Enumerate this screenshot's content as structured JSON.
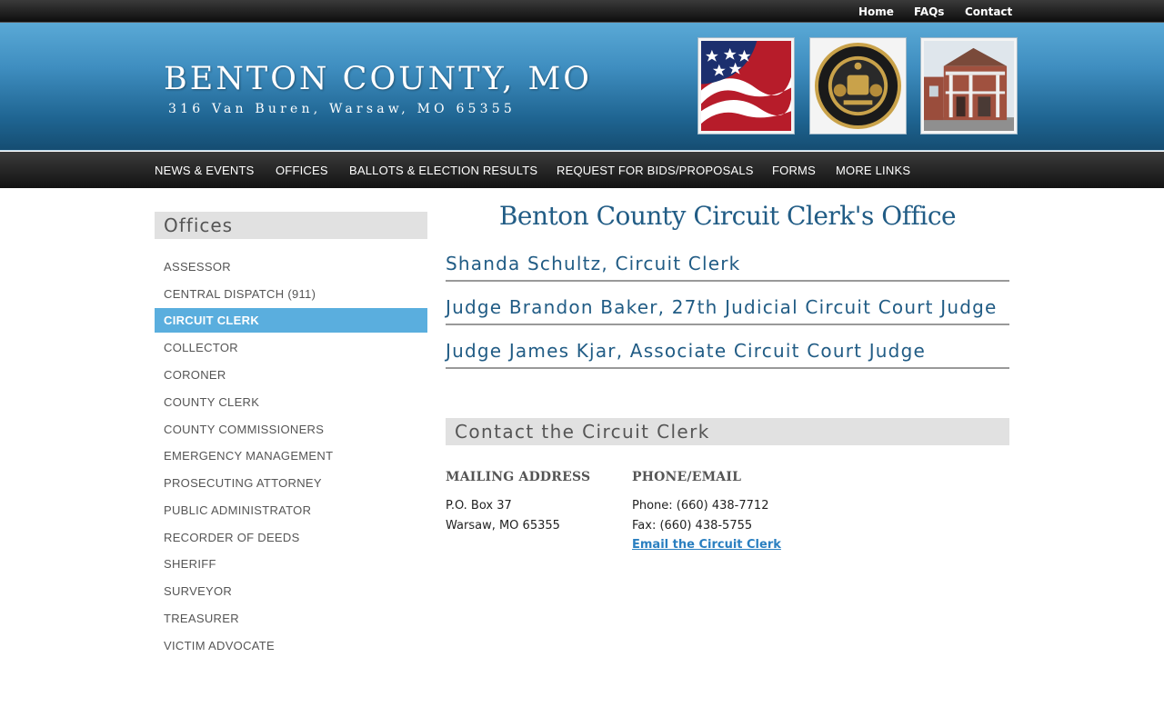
{
  "topnav": {
    "home": "Home",
    "faqs": "FAQs",
    "contact": "Contact"
  },
  "header": {
    "title": "BENTON COUNTY, MO",
    "address": "316 Van Buren, Warsaw, MO 65355"
  },
  "mainnav": {
    "news": "NEWS & EVENTS",
    "offices": "OFFICES",
    "ballots": "BALLOTS & ELECTION RESULTS",
    "bids": "REQUEST FOR BIDS/PROPOSALS",
    "forms": "FORMS",
    "more": "MORE LINKS"
  },
  "sidebar": {
    "title": "Offices",
    "items": [
      {
        "label": "ASSESSOR"
      },
      {
        "label": "CENTRAL DISPATCH (911)"
      },
      {
        "label": "CIRCUIT CLERK"
      },
      {
        "label": "COLLECTOR"
      },
      {
        "label": "CORONER"
      },
      {
        "label": "COUNTY CLERK"
      },
      {
        "label": "COUNTY COMMISSIONERS"
      },
      {
        "label": "EMERGENCY MANAGEMENT"
      },
      {
        "label": "PROSECUTING ATTORNEY"
      },
      {
        "label": "PUBLIC ADMINISTRATOR"
      },
      {
        "label": "RECORDER OF DEEDS"
      },
      {
        "label": "SHERIFF"
      },
      {
        "label": "SURVEYOR"
      },
      {
        "label": "TREASURER"
      },
      {
        "label": "VICTIM ADVOCATE"
      }
    ],
    "active_item": "CIRCUIT CLERK"
  },
  "main": {
    "title": "Benton County Circuit Clerk's Office",
    "people": [
      {
        "label": "Shanda Schultz, Circuit Clerk"
      },
      {
        "label": "Judge Brandon Baker, 27th Judicial Circuit Court Judge"
      },
      {
        "label": "Judge James Kjar, Associate Circuit Court Judge"
      }
    ],
    "contact_heading": "Contact the Circuit Clerk",
    "mailing": {
      "heading": "MAILING ADDRESS",
      "line1": "P.O. Box 37",
      "line2": "Warsaw, MO 65355"
    },
    "phone_email": {
      "heading": "PHONE/EMAIL",
      "phone": "Phone: (660) 438-7712",
      "fax": "Fax: (660) 438-5755",
      "email_link": "Email the Circuit Clerk"
    }
  },
  "colors": {
    "brand_blue": "#215c85",
    "active_item": "#5aaede",
    "link": "#2a7fc0"
  },
  "icons": [
    "american-flag-photo",
    "missouri-state-seal",
    "courthouse-photo"
  ]
}
